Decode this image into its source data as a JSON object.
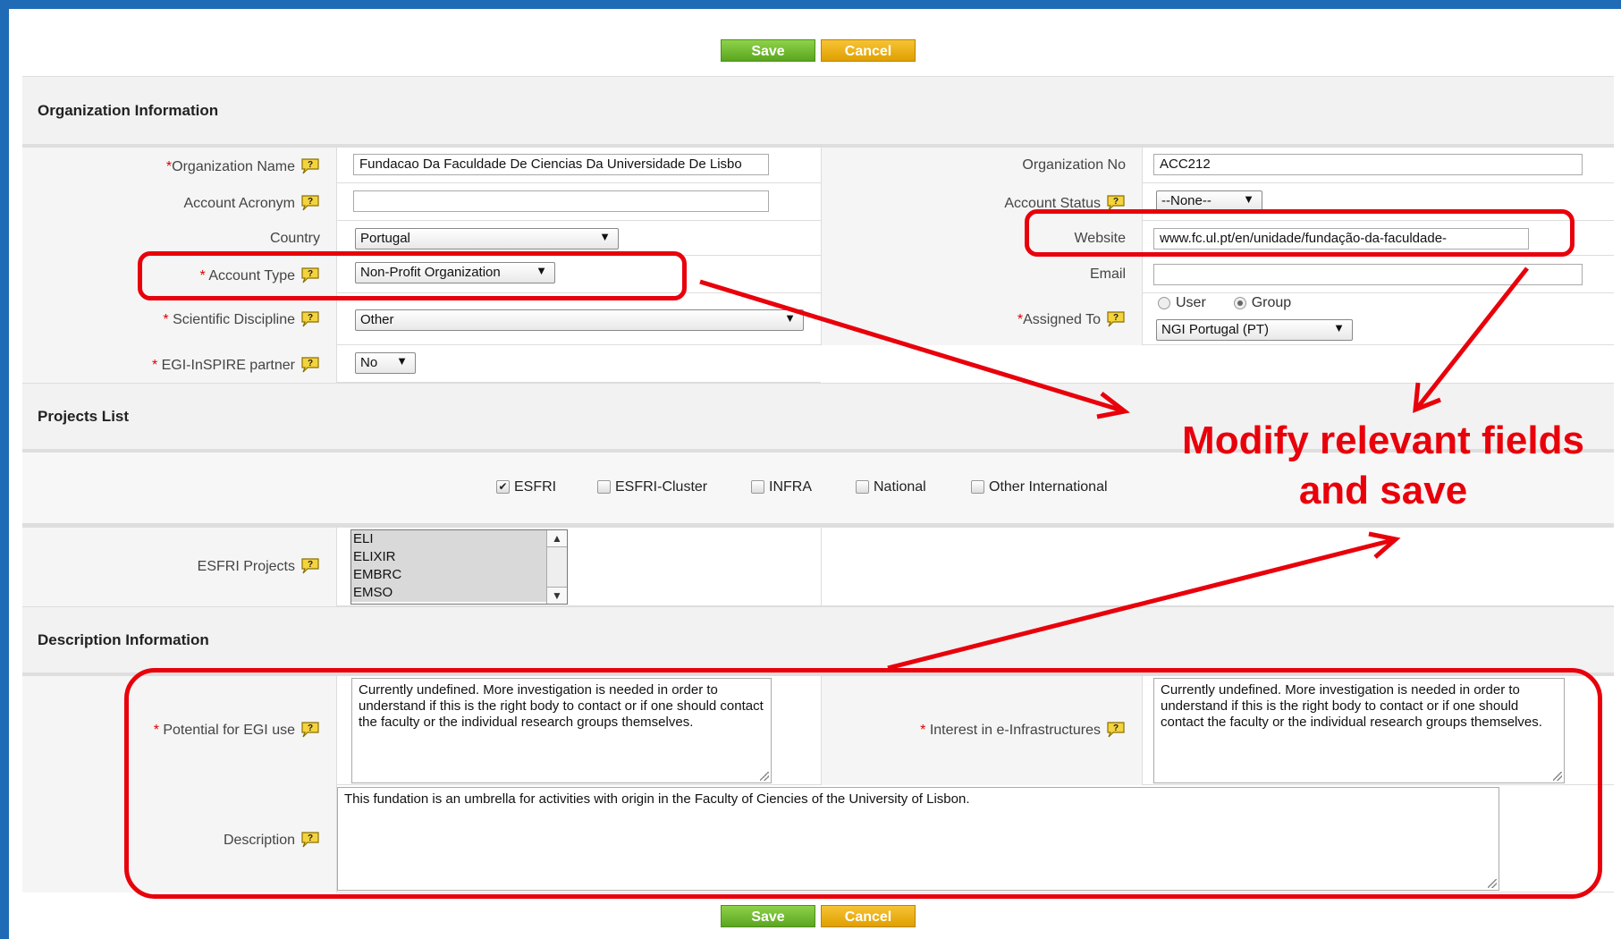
{
  "toolbar": {
    "save_label": "Save",
    "cancel_label": "Cancel"
  },
  "sections": {
    "org": "Organization Information",
    "projects": "Projects List",
    "desc": "Description Information"
  },
  "org": {
    "org_name_label": "Organization Name",
    "org_name_value": "Fundacao Da Faculdade De Ciencias Da Universidade De Lisbo",
    "acronym_label": "Account Acronym",
    "acronym_value": "",
    "country_label": "Country",
    "country_value": "Portugal",
    "account_type_label": "Account Type",
    "account_type_value": "Non-Profit Organization",
    "discipline_label": "Scientific Discipline",
    "discipline_value": "Other",
    "partner_label": "EGI-InSPIRE partner",
    "partner_value": "No",
    "org_no_label": "Organization No",
    "org_no_value": "ACC212",
    "status_label": "Account Status",
    "status_value": "--None--",
    "website_label": "Website",
    "website_value": "www.fc.ul.pt/en/unidade/fundação-da-faculdade-",
    "email_label": "Email",
    "email_value": "",
    "assigned_label": "Assigned To",
    "assigned_user": "User",
    "assigned_group": "Group",
    "assigned_value": "NGI Portugal (PT)"
  },
  "projects": {
    "checkboxes": [
      "ESFRI",
      "ESFRI-Cluster",
      "INFRA",
      "National",
      "Other International"
    ],
    "checked": [
      "ESFRI"
    ],
    "esfri_label": "ESFRI Projects",
    "esfri_options": [
      "ELI",
      "ELIXIR",
      "EMBRC",
      "EMSO"
    ]
  },
  "desc": {
    "potential_label": "Potential for EGI use",
    "potential_value": "Currently undefined. More investigation is needed in order to understand if this is the right body to contact or if one should contact the faculty or the individual research groups themselves.",
    "interest_label": "Interest in e-Infrastructures",
    "interest_value": "Currently undefined. More investigation is needed in order to understand if this is the right body to contact or if one should contact the faculty or the individual research groups themselves.",
    "description_label": "Description",
    "description_value": "This fundation is an umbrella for activities with origin in the Faculty of Ciencies of the University of Lisbon."
  },
  "annotation": {
    "text_line1": "Modify relevant fields",
    "text_line2": "and save",
    "color": "#e8000b"
  },
  "colors": {
    "frame": "#1f6bb5",
    "save": "#6ab32b",
    "cancel": "#f0b400"
  }
}
